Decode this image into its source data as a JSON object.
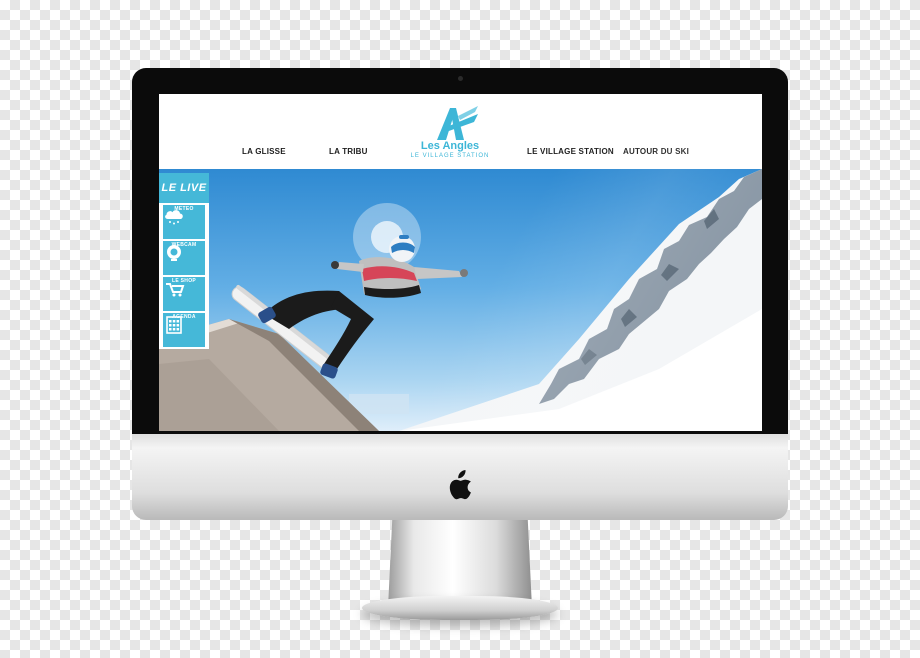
{
  "site": {
    "nav": [
      {
        "label": "LA GLISSE"
      },
      {
        "label": "LA TRIBU"
      },
      {
        "label": "LE VILLAGE STATION"
      },
      {
        "label": "AUTOUR DU SKI"
      }
    ],
    "logo": {
      "name": "Les Angles",
      "tagline": "LE VILLAGE STATION"
    },
    "live": {
      "title": "LE LIVE",
      "items": [
        {
          "label": "METEO",
          "icon": "weather-cloud-icon"
        },
        {
          "label": "WEBCAM",
          "icon": "webcam-icon"
        },
        {
          "label": "LE SHOP",
          "icon": "shop-icon"
        },
        {
          "label": "AGENDA",
          "icon": "calendar-icon"
        }
      ]
    },
    "colors": {
      "accent": "#45b8d8",
      "logo": "#3db6d7",
      "nav_text": "#1d1d1d"
    }
  },
  "device": {
    "type": "imac",
    "logo_icon": "apple-logo-icon"
  }
}
